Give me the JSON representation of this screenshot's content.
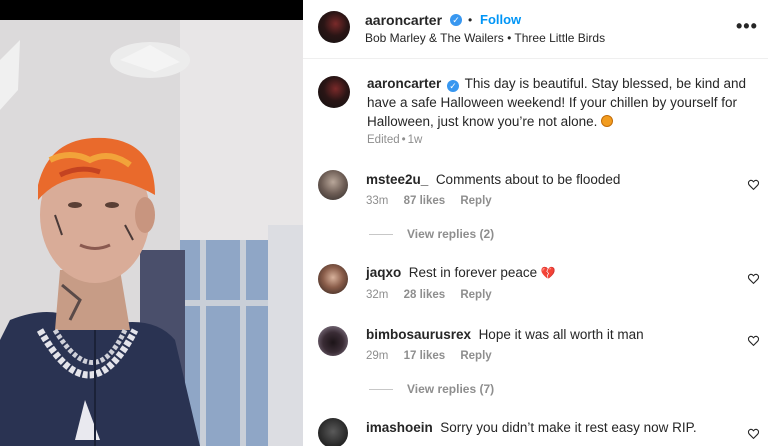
{
  "post": {
    "username": "aaroncarter",
    "follow_label": "Follow",
    "separator": "•",
    "audio": {
      "artist": "Bob Marley & The Wailers",
      "song": "Three Little Birds"
    },
    "more_label": "•••"
  },
  "caption": {
    "username": "aaroncarter",
    "text": "This day is beautiful. Stay blessed, be kind and have a safe Halloween weekend! If your chillen by yourself for Halloween, just know you’re not alone.",
    "edited_label": "Edited",
    "age": "1w"
  },
  "comments": [
    {
      "username": "mstee2u_",
      "text": "Comments about to be flooded",
      "age": "33m",
      "likes": "87 likes",
      "reply_label": "Reply",
      "view_replies": "View replies (2)"
    },
    {
      "username": "jaqxo",
      "text": "Rest in forever peace",
      "emoji": "💔",
      "age": "32m",
      "likes": "28 likes",
      "reply_label": "Reply"
    },
    {
      "username": "bimbosaurusrex",
      "text": "Hope it was all worth it man",
      "age": "29m",
      "likes": "17 likes",
      "reply_label": "Reply",
      "view_replies": "View replies (7)"
    },
    {
      "username": "imashoein",
      "text": "Sorry you didn’t make it rest easy now RIP."
    }
  ],
  "colors": {
    "link_blue": "#0095f6",
    "verified_blue": "#3897f0",
    "muted_text": "#8e8e8e",
    "text": "#262626"
  },
  "icons": {
    "verified": "verified-badge-icon",
    "heart": "heart-outline-icon",
    "more": "more-options-icon"
  }
}
